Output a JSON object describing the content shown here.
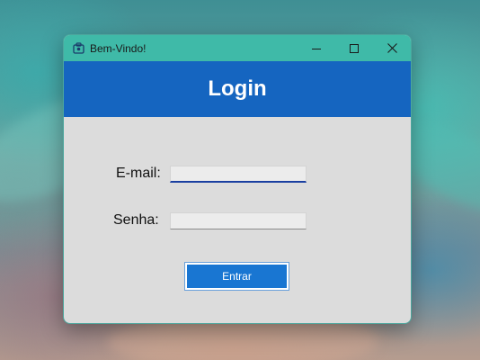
{
  "window": {
    "title": "Bem-Vindo!",
    "icon": "app-icon",
    "controls": [
      "minimize-icon",
      "maximize-icon",
      "close-icon"
    ]
  },
  "header": {
    "title": "Login",
    "color": "#1565c0"
  },
  "form": {
    "email_label": "E-mail:",
    "email_value": "",
    "password_label": "Senha:",
    "password_value": "",
    "submit_label": "Entrar"
  },
  "colors": {
    "titlebar": "#3fbaa8",
    "accent": "#1976d2",
    "body": "#dcdcdc"
  }
}
